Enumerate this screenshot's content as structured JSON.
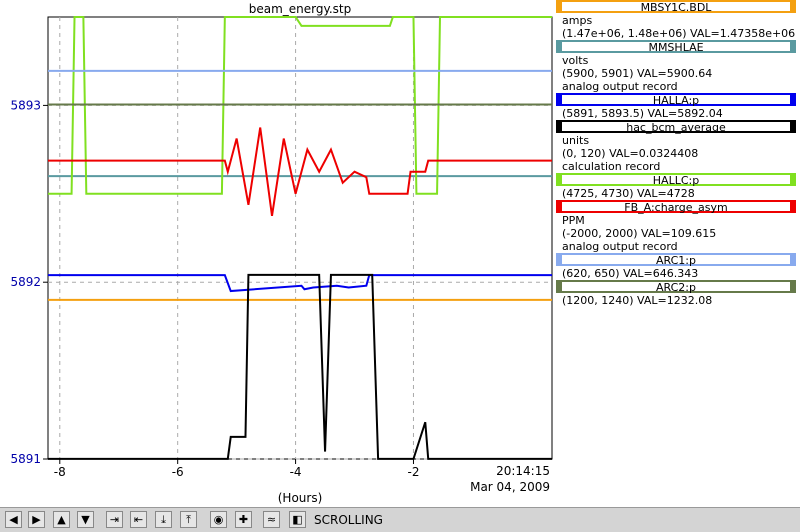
{
  "chart_data": {
    "type": "line",
    "title": "beam_energy.stp",
    "xlabel": "(Hours)",
    "ylabel": "",
    "xlim": [
      -8.2,
      0.35
    ],
    "ylim": [
      5891,
      5893.5
    ],
    "x_ticks": [
      -8,
      -6,
      -4,
      -2
    ],
    "x_tick_labels": [
      "-8",
      "-6",
      "-4",
      "-2"
    ],
    "y_ticks": [
      5891,
      5892,
      5893
    ],
    "y_tick_labels": [
      "5891",
      "5892",
      "5893"
    ],
    "time_label": "20:14:15",
    "date_label": "Mar 04, 2009",
    "grid": true,
    "series": [
      {
        "name": "HALLA:p",
        "color": "#0000ee",
        "x": [
          -8.2,
          -5.2,
          -5.1,
          -3.9,
          -3.85,
          -3.7,
          -3.3,
          -3.1,
          -2.8,
          -2.75,
          -2.1,
          -1.75,
          0.35
        ],
        "y": [
          5892.04,
          5892.04,
          5891.95,
          5891.98,
          5891.96,
          5891.97,
          5891.98,
          5891.97,
          5891.98,
          5892.04,
          5892.04,
          5892.04,
          5892.04
        ]
      },
      {
        "name": "hac_bcm_average",
        "color": "#000000",
        "x": [
          -8.2,
          -5.15,
          -5.1,
          -4.85,
          -4.8,
          -4.3,
          -3.6,
          -3.5,
          -3.4,
          -2.7,
          -2.6,
          -2.0,
          -1.8,
          -1.75,
          0.35
        ],
        "y": [
          0.03,
          0.03,
          6,
          6,
          50,
          50,
          50,
          2,
          50,
          50,
          0.03,
          0.03,
          10,
          0.03,
          0.03
        ]
      },
      {
        "name": "HALLC:p",
        "color": "#80e020",
        "x": [
          -8.2,
          -7.8,
          -7.75,
          -7.6,
          -7.55,
          -5.25,
          -5.2,
          -4.0,
          -3.9,
          -2.4,
          -2.35,
          -2.0,
          -1.95,
          -1.6,
          -1.55,
          0.35
        ],
        "y": [
          4728,
          4728,
          4730,
          4730,
          4728,
          4728,
          4730,
          4730,
          4729.9,
          4729.9,
          4730,
          4730,
          4728,
          4728,
          4730,
          4730
        ]
      },
      {
        "name": "FB_A:charge_asym",
        "color": "#ee0000",
        "x": [
          -8.2,
          -5.2,
          -5.15,
          -5.0,
          -4.8,
          -4.6,
          -4.4,
          -4.2,
          -4.0,
          -3.8,
          -3.6,
          -3.4,
          -3.2,
          -3.0,
          -2.8,
          -2.75,
          -2.1,
          -2.05,
          -1.8,
          -1.75,
          0.35
        ],
        "y": [
          700,
          700,
          600,
          900,
          300,
          1000,
          200,
          900,
          400,
          800,
          600,
          800,
          500,
          600,
          550,
          400,
          400,
          600,
          600,
          700,
          700
        ]
      },
      {
        "name": "ARC1:p",
        "color": "#88aaee",
        "x": [
          -8.2,
          0.35
        ],
        "y": [
          646.343,
          646.343
        ]
      },
      {
        "name": "ARC2:p",
        "color": "#667a4a",
        "x": [
          -8.2,
          0.35
        ],
        "y": [
          1232.08,
          1232.08
        ]
      }
    ],
    "hlines": [
      {
        "name": "MMSHLAE",
        "color": "#5a9aa0",
        "y": 5892.6
      },
      {
        "name": "MBSY1C.BDL",
        "color": "#f4a010",
        "y": 5891.9
      }
    ]
  },
  "legend": [
    {
      "name": "MBSY1C.BDL",
      "color": "#f4a010",
      "lines": [
        "amps",
        "(1.47e+06, 1.48e+06)  VAL=1.47358e+06"
      ]
    },
    {
      "name": "MMSHLAE",
      "color": "#5a9aa0",
      "lines": [
        "volts",
        "(5900, 5901)  VAL=5900.64",
        "analog output record"
      ]
    },
    {
      "name": "HALLA:p",
      "color": "#0000ee",
      "lines": [
        "(5891, 5893.5)  VAL=5892.04"
      ]
    },
    {
      "name": "hac_bcm_average",
      "color": "#000000",
      "lines": [
        "units",
        "(0, 120)  VAL=0.0324408",
        "calculation record"
      ]
    },
    {
      "name": "HALLC:p",
      "color": "#80e020",
      "lines": [
        "(4725, 4730)  VAL=4728"
      ]
    },
    {
      "name": "FB_A:charge_asym",
      "color": "#ee0000",
      "lines": [
        "PPM",
        "(-2000, 2000)  VAL=109.615",
        "analog output record"
      ]
    },
    {
      "name": "ARC1:p",
      "color": "#88aaee",
      "lines": [
        "(620, 650)  VAL=646.343"
      ]
    },
    {
      "name": "ARC2:p",
      "color": "#667a4a",
      "lines": [
        "(1200, 1240)  VAL=1232.08"
      ]
    }
  ],
  "toolbar": {
    "buttons": [
      {
        "name": "pan-left-button",
        "glyph": "◀"
      },
      {
        "name": "pan-right-button",
        "glyph": "▶"
      },
      {
        "name": "pan-up-button",
        "glyph": "▲"
      },
      {
        "name": "pan-down-button",
        "glyph": "▼"
      },
      {
        "name": "zoom-in-horizontal-button",
        "glyph": "⇥"
      },
      {
        "name": "zoom-out-horizontal-button",
        "glyph": "⇤"
      },
      {
        "name": "zoom-in-vertical-button",
        "glyph": "⤓"
      },
      {
        "name": "zoom-out-vertical-button",
        "glyph": "⤒"
      },
      {
        "name": "auto-scale-button",
        "glyph": "◉"
      },
      {
        "name": "plus-button",
        "glyph": "✚"
      },
      {
        "name": "config-button",
        "glyph": "≈"
      },
      {
        "name": "stop-button",
        "glyph": "◧"
      }
    ],
    "mode_label": "SCROLLING"
  }
}
